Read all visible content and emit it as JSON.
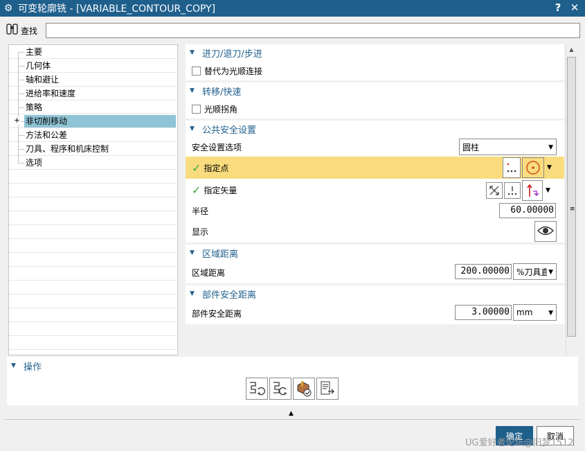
{
  "window": {
    "title": "可变轮廓铣 - [VARIABLE_CONTOUR_COPY]",
    "icon": "gear-icon",
    "help": "?",
    "close": "✕"
  },
  "search": {
    "label": "查找",
    "value": ""
  },
  "tree": {
    "items": [
      {
        "label": "主要",
        "selected": false
      },
      {
        "label": "几何体",
        "selected": false
      },
      {
        "label": "轴和避让",
        "selected": false
      },
      {
        "label": "进给率和速度",
        "selected": false
      },
      {
        "label": "策略",
        "selected": false
      },
      {
        "label": "非切削移动",
        "selected": true,
        "expander": "+"
      },
      {
        "label": "方法和公差",
        "selected": false
      },
      {
        "label": "刀具、程序和机床控制",
        "selected": false
      },
      {
        "label": "选项",
        "selected": false
      }
    ]
  },
  "groups": {
    "engage": {
      "title": "进刀/退刀/步进",
      "checkbox_label": "替代为光顺连接"
    },
    "transfer": {
      "title": "转移/快速",
      "checkbox_label": "光顺拐角"
    },
    "safety": {
      "title": "公共安全设置",
      "option_label": "安全设置选项",
      "option_value": "圆柱",
      "point_label": "指定点",
      "vector_label": "指定矢量",
      "radius_label": "半径",
      "radius_value": "60.00000",
      "display_label": "显示"
    },
    "region": {
      "title": "区域距离",
      "label": "区域距离",
      "value": "200.00000",
      "unit": "%刀具直"
    },
    "part": {
      "title": "部件安全距离",
      "label": "部件安全距离",
      "value": "3.00000",
      "unit": "mm"
    }
  },
  "operations": {
    "title": "操作"
  },
  "buttons": {
    "ok": "确定",
    "cancel": "取消"
  },
  "watermark": "UG爱好者论坛@旧梦1512",
  "colors": {
    "title_bar": "#1f5f8c",
    "selected_tree": "#8fc4d6",
    "highlight_row": "#f9dc7e",
    "check_green": "#3aa53a"
  }
}
